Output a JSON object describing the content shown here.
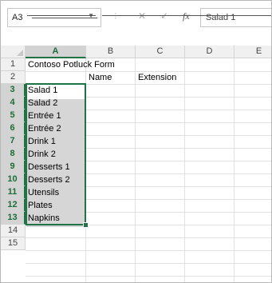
{
  "formula_bar": {
    "name_box": "A3",
    "cancel_glyph": "✕",
    "enter_glyph": "✓",
    "fx_label": "fx",
    "formula_value": "Salad 1"
  },
  "columns": [
    "A",
    "B",
    "C",
    "D",
    "E"
  ],
  "rows": [
    "1",
    "2",
    "3",
    "4",
    "5",
    "6",
    "7",
    "8",
    "9",
    "10",
    "11",
    "12",
    "13",
    "14",
    "15"
  ],
  "cells": {
    "A1": "Contoso Potluck Form",
    "B2": "Name",
    "C2": "Extension",
    "A3": "Salad 1",
    "A4": "Salad 2",
    "A5": "Entrée 1",
    "A6": "Entrée 2",
    "A7": "Drink 1",
    "A8": "Drink 2",
    "A9": "Desserts 1",
    "A10": "Desserts 2",
    "A11": "Utensils",
    "A12": "Plates",
    "A13": "Napkins"
  },
  "selection": {
    "range": "A3:A13",
    "active_cell": "A3"
  },
  "colors": {
    "accent": "#217346",
    "selection_fill": "#d6d6d6",
    "header_bg": "#f0f0f0"
  },
  "icons": [
    "dropdown-arrow-icon",
    "cancel-icon",
    "enter-icon",
    "fx-icon",
    "select-all-icon"
  ]
}
